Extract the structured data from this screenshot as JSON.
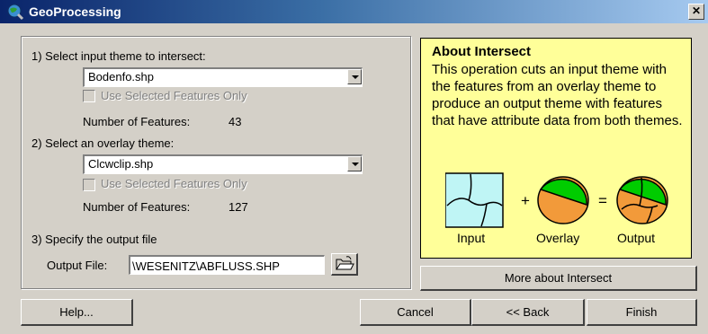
{
  "window": {
    "title": "GeoProcessing"
  },
  "step1": {
    "label": "1) Select input theme to intersect:",
    "theme_value": "Bodenfo.shp",
    "checkbox_label": "Use Selected Features Only",
    "count_label": "Number of Features:",
    "count_value": "43"
  },
  "step2": {
    "label": "2) Select an overlay theme:",
    "theme_value": "Clcwclip.shp",
    "checkbox_label": "Use Selected Features Only",
    "count_label": "Number of Features:",
    "count_value": "127"
  },
  "step3": {
    "label": "3) Specify the output file",
    "output_label": "Output File:",
    "output_value": "\\WESENITZ\\ABFLUSS.SHP"
  },
  "about": {
    "heading": "About Intersect",
    "body": "This operation cuts an input theme with the  features from an overlay theme to produce an output theme with features that have attribute data from both themes.",
    "plus": "+",
    "equals": "=",
    "caption_input": "Input",
    "caption_overlay": "Overlay",
    "caption_output": "Output"
  },
  "buttons": {
    "more": "More about Intersect",
    "help": "Help...",
    "cancel": "Cancel",
    "back": "<< Back",
    "finish": "Finish"
  },
  "icons": {
    "title": "globe-icon",
    "close": "close-icon",
    "browse": "open-folder-icon"
  },
  "colors": {
    "title_bar": "#0a246a",
    "dialog": "#d4d0c8",
    "about_panel": "#ffff99",
    "overlay_green": "#00cc00",
    "overlay_orange": "#f29a3a",
    "input_fill": "#bff5f5"
  }
}
